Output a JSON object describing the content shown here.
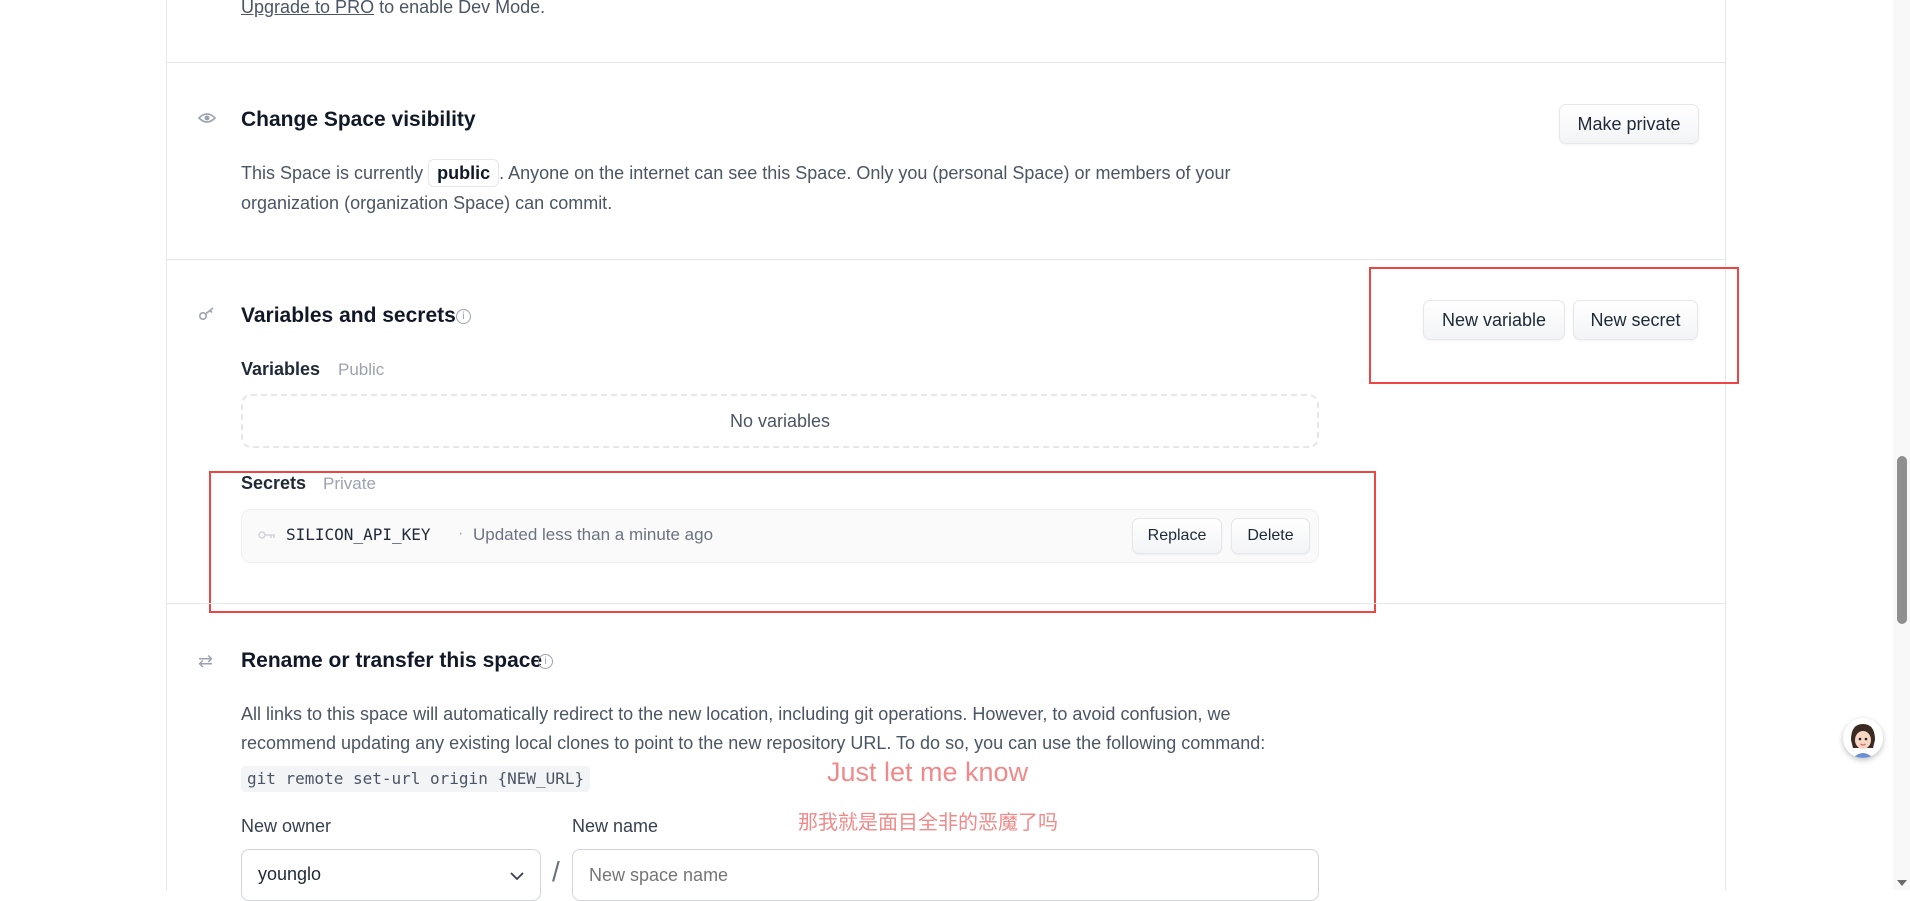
{
  "dev_mode": {
    "link": "Upgrade to PRO",
    "text": " to enable Dev Mode."
  },
  "visibility": {
    "icon": "eye-icon",
    "title": "Change Space visibility",
    "desc_before": "This Space is currently",
    "badge": "public",
    "desc_after": ". Anyone on the internet can see this Space. Only you (personal Space) or members of your",
    "desc_line2": "organization (organization Space) can commit.",
    "button": "Make private"
  },
  "variables": {
    "icon": "key-pencil-icon",
    "title": "Variables and secrets",
    "new_variable": "New variable",
    "new_secret": "New secret",
    "variables_label": "Variables",
    "variables_tag": "Public",
    "empty": "No variables",
    "secrets_label": "Secrets",
    "secrets_tag": "Private",
    "secret": {
      "name": "SILICON_API_KEY",
      "separator": "·",
      "updated": "Updated less than a minute ago",
      "replace": "Replace",
      "delete": "Delete"
    }
  },
  "rename": {
    "icon": "transfer-arrows-icon",
    "title": "Rename or transfer this space",
    "line1": "All links to this space will automatically redirect to the new location, including git operations. However, to avoid confusion, we",
    "line2": "recommend updating any existing local clones to point to the new repository URL. To do so, you can use the following command:",
    "command": "git remote set-url origin {NEW_URL}",
    "owner_label": "New owner",
    "owner_value": "younglo",
    "slash": "/",
    "name_label": "New name",
    "name_placeholder": "New space name"
  },
  "overlay": {
    "subtitle_en": "Just let me know",
    "subtitle_zh": "那我就是面目全非的恶魔了吗"
  },
  "colors": {
    "highlight": "#ef4444",
    "subtitle": "#f08a8a"
  }
}
